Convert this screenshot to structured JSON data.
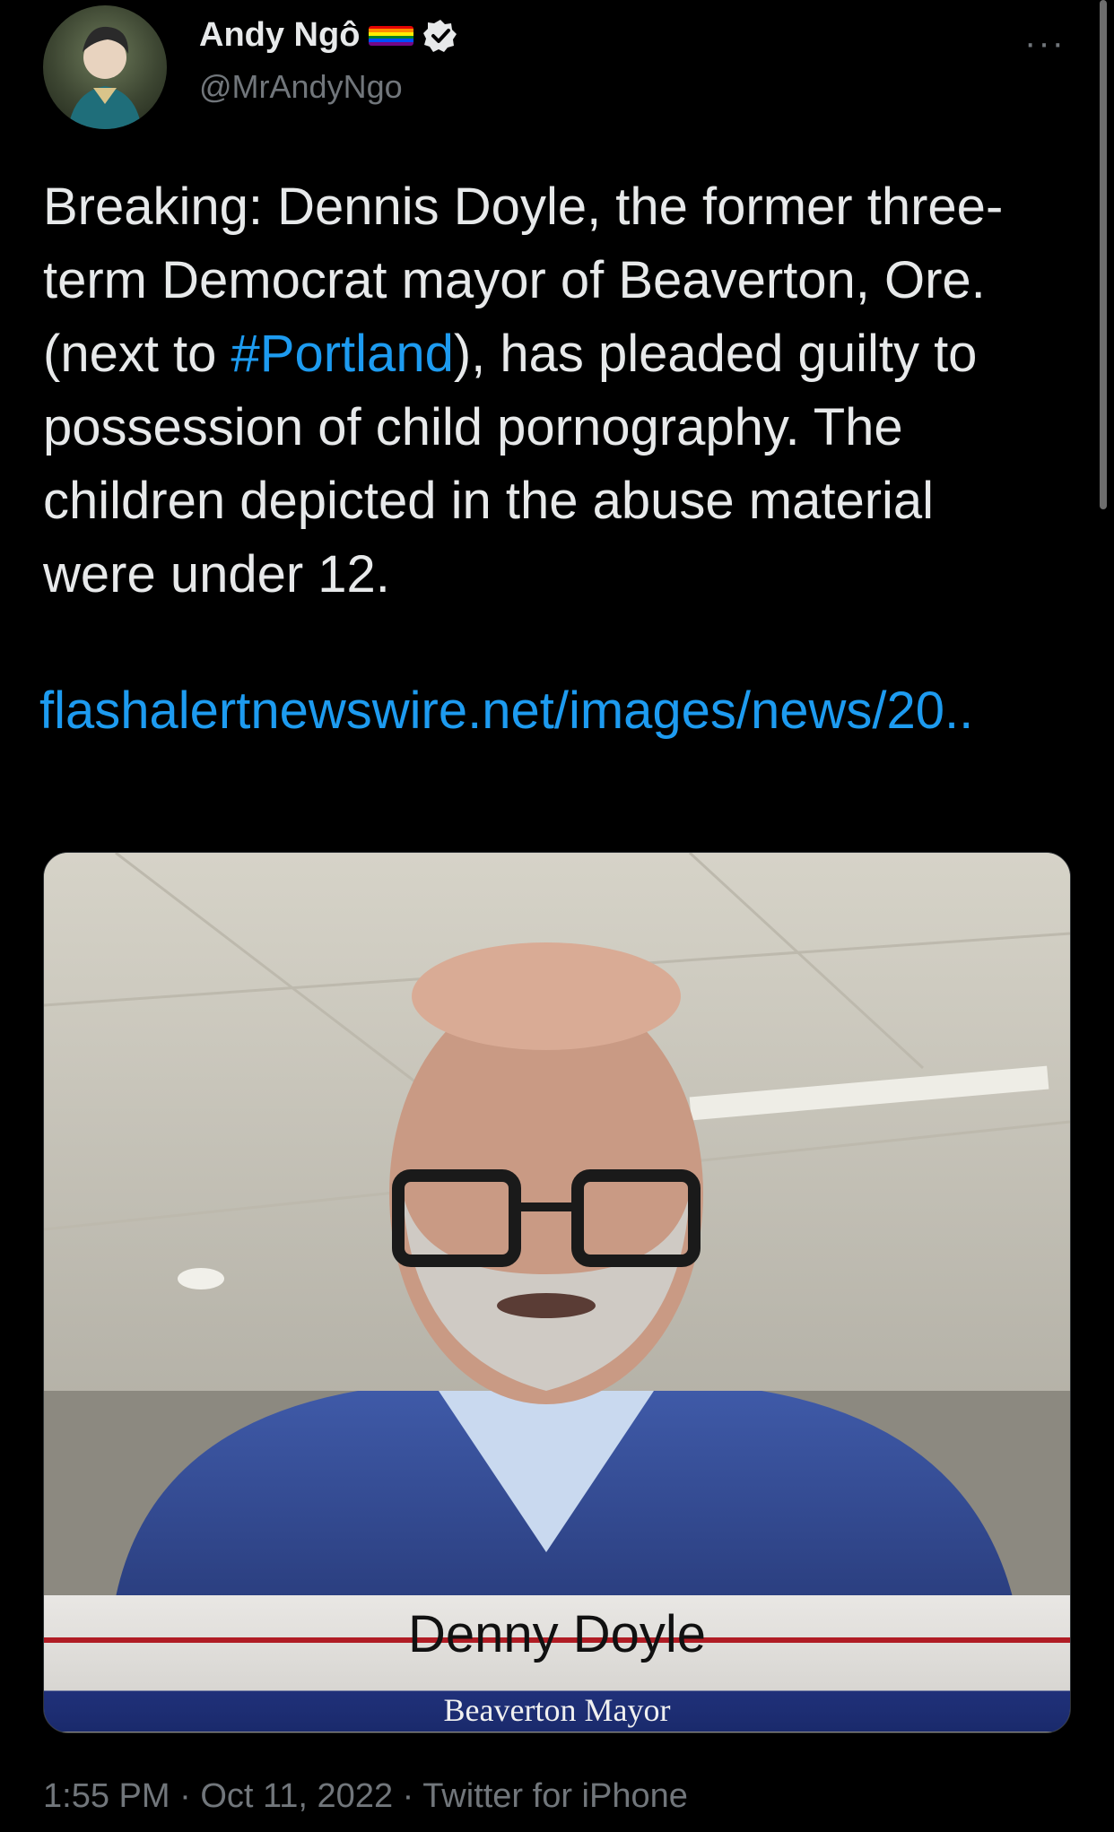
{
  "author": {
    "name": "Andy Ngô",
    "handle": "@MrAndyNgo",
    "more_label": "···"
  },
  "tweet": {
    "text_before": "Breaking: Dennis Doyle, the former three-term Democrat mayor of Beaverton, Ore. (next to ",
    "hashtag": "#Portland",
    "text_after": "), has pleaded guilty to possession of child pornography. The children depicted in the abuse material were under 12.",
    "link": "flashalertnewswire.net/images/news/20.."
  },
  "media": {
    "caption_name": "Denny Doyle",
    "caption_title": "Beaverton Mayor"
  },
  "meta": {
    "time": "1:55 PM",
    "date": "Oct 11, 2022",
    "source": "Twitter for iPhone"
  },
  "colors": {
    "link": "#1d9bf0",
    "background": "#000000",
    "secondary_text": "#71767b"
  }
}
